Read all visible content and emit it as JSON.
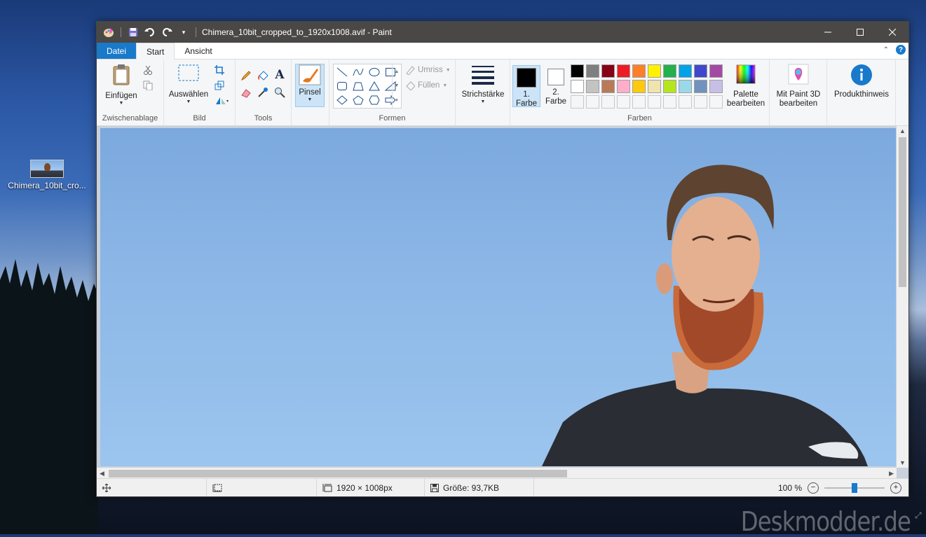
{
  "desktop": {
    "icon_label": "Chimera_10bit_cro...",
    "watermark": "Deskmodder.de"
  },
  "window": {
    "title": "Chimera_10bit_cropped_to_1920x1008.avif - Paint",
    "controls": [
      "minimize",
      "maximize",
      "close"
    ]
  },
  "tabs": [
    {
      "label": "Datei"
    },
    {
      "label": "Start"
    },
    {
      "label": "Ansicht"
    }
  ],
  "ribbon": {
    "clipboard": {
      "paste_label": "Einfügen",
      "group_label": "Zwischenablage"
    },
    "image": {
      "select_label": "Auswählen",
      "group_label": "Bild"
    },
    "tools": {
      "group_label": "Tools"
    },
    "brushes": {
      "label": "Pinsel"
    },
    "shapes": {
      "outline_label": "Umriss",
      "fill_label": "Füllen",
      "group_label": "Formen"
    },
    "size": {
      "label": "Strichstärke"
    },
    "colors": {
      "color1_label": "1.",
      "color1_sub": "Farbe",
      "color2_label": "2.",
      "color2_sub": "Farbe",
      "edit_label": "Palette",
      "edit_sub": "bearbeiten",
      "group_label": "Farben",
      "color1": "#000000",
      "color2": "#ffffff",
      "palette_row1": [
        "#000000",
        "#7f7f7f",
        "#880015",
        "#ed1c24",
        "#ff7f27",
        "#fff200",
        "#22b14c",
        "#00a2e8",
        "#3f48cc",
        "#a349a4"
      ],
      "palette_row2": [
        "#ffffff",
        "#c3c3c3",
        "#b97a57",
        "#ffaec9",
        "#ffc90e",
        "#efe4b0",
        "#b5e61d",
        "#99d9ea",
        "#7092be",
        "#c8bfe7"
      ]
    },
    "paint3d": {
      "label": "Mit Paint 3D",
      "sub": "bearbeiten"
    },
    "product": {
      "label": "Produkthinweis"
    }
  },
  "status": {
    "dimensions": "1920 × 1008px",
    "size": "Größe: 93,7KB",
    "zoom": "100 %",
    "zoom_level": 0.5
  }
}
